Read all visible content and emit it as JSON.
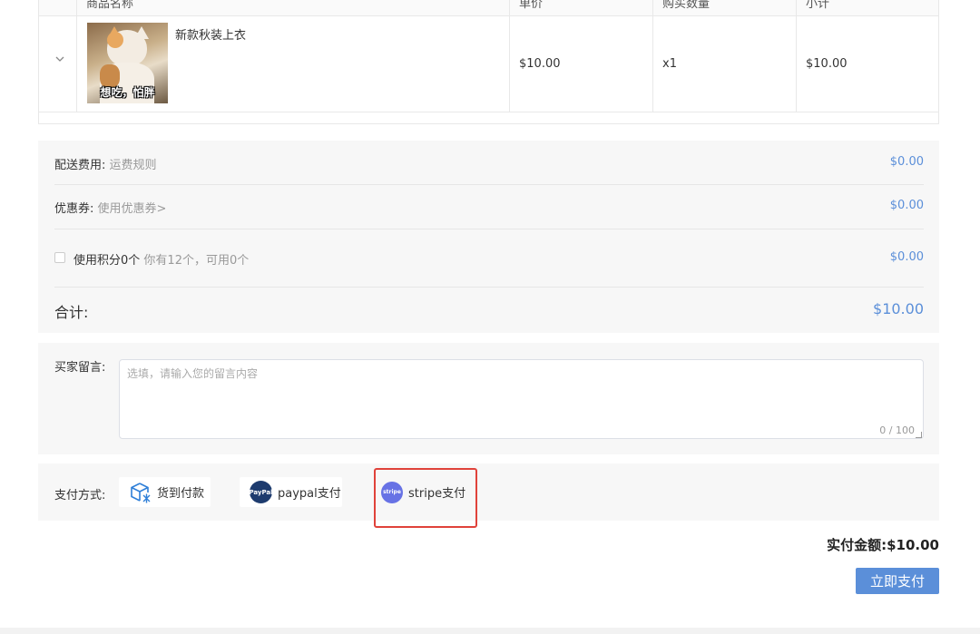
{
  "table": {
    "headers": [
      "商品名称",
      "单价",
      "购买数量",
      "小计"
    ],
    "items": [
      {
        "name": "新款秋装上衣",
        "image_caption": "想吃，怕胖",
        "price": "$10.00",
        "quantity": "x1",
        "subtotal": "$10.00"
      }
    ]
  },
  "summary": {
    "shipping_label": "配送费用:",
    "shipping_link": "运费规则",
    "shipping_value": "$0.00",
    "coupon_label": "优惠券:",
    "coupon_link": "使用优惠券>",
    "coupon_value": "$0.00",
    "points_label": "使用积分0个",
    "points_hint": "你有12个，可用0个",
    "points_value": "$0.00",
    "total_label": "合计:",
    "total_value": "$10.00"
  },
  "message": {
    "label": "买家留言:",
    "placeholder": "选填，请输入您的留言内容",
    "value": "",
    "counter": "0 / 100"
  },
  "payment": {
    "label": "支付方式:",
    "options": [
      {
        "label": "货到付款",
        "icon": "box-delivery-icon"
      },
      {
        "label": "paypal支付",
        "icon": "paypal-logo",
        "logo_text": "PayPal"
      },
      {
        "label": "stripe支付",
        "icon": "stripe-logo",
        "logo_text": "stripe"
      }
    ],
    "selected": "stripe支付"
  },
  "checkout": {
    "actual_amount": "实付金额:$10.00",
    "pay_button": "立即支付"
  },
  "colors": {
    "accent": "#5b8fd9",
    "highlight_border": "#e0423a"
  }
}
